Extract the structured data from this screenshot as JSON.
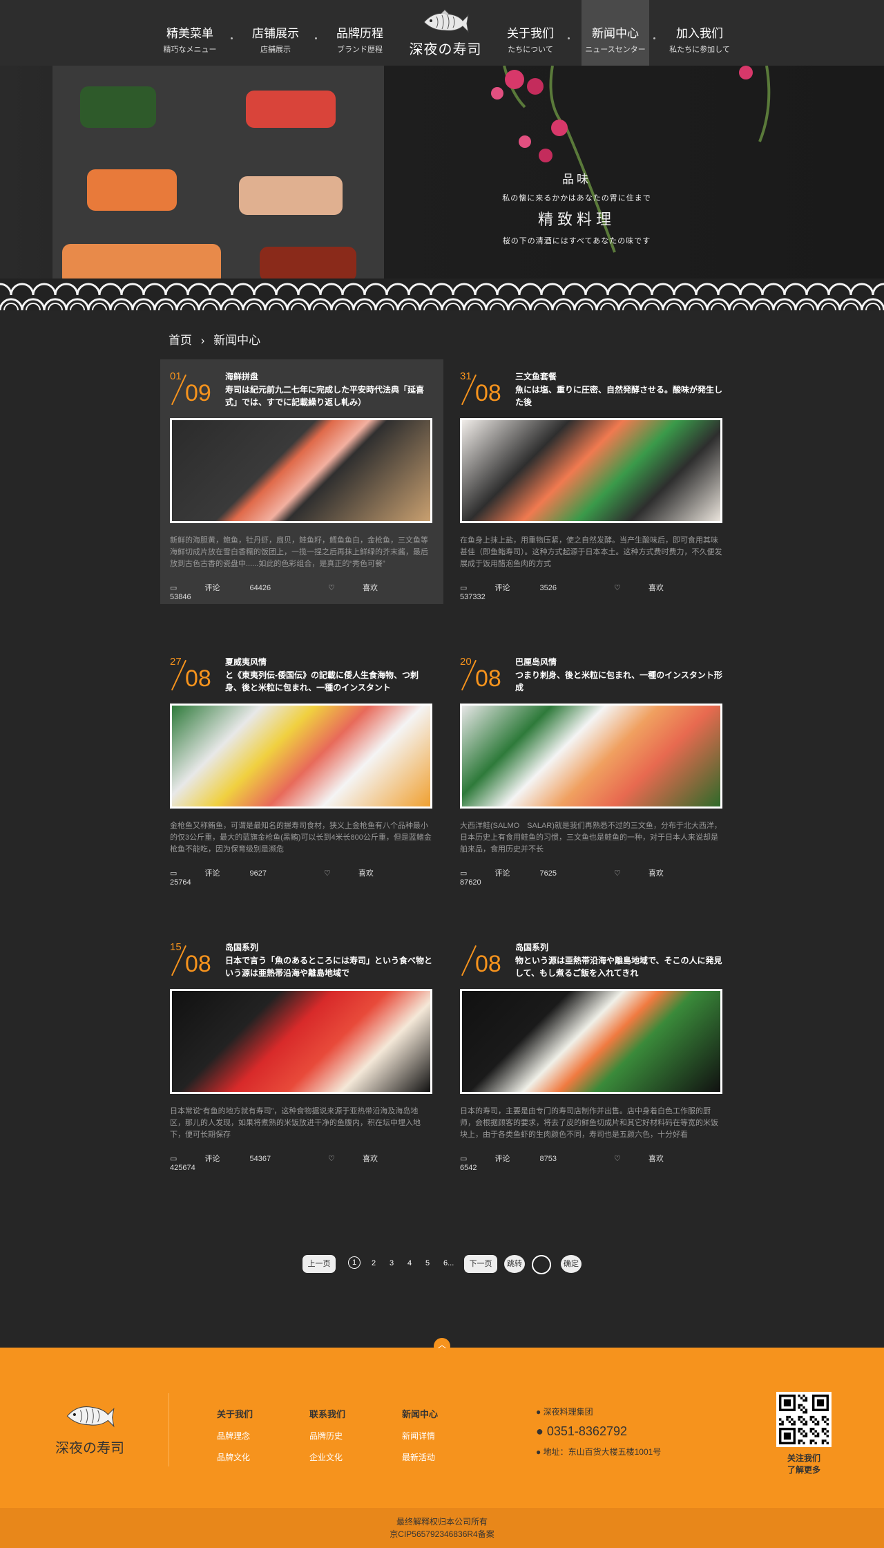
{
  "nav": {
    "items": [
      {
        "cn": "精美菜单",
        "jp": "精巧なメニュー"
      },
      {
        "cn": "店铺展示",
        "jp": "店舗展示"
      },
      {
        "cn": "品牌历程",
        "jp": "ブランド歴程"
      },
      {
        "cn": "关于我们",
        "jp": "たちについて"
      },
      {
        "cn": "新闻中心",
        "jp": "ニュースセンター"
      },
      {
        "cn": "加入我们",
        "jp": "私たちに参加して"
      }
    ],
    "logo_text": "深夜の寿司",
    "logo_icon": "fish-icon"
  },
  "banner": {
    "line1": "品味",
    "line2": "私の懐に来るかかはあなたの胃に住まで",
    "line3": "精致料理",
    "line4": "桜の下の清酒にはすべてあなたの味です"
  },
  "breadcrumb": {
    "home": "首页",
    "sep": "›",
    "current": "新闻中心"
  },
  "news": [
    {
      "day": "01",
      "month": "09",
      "category": "海鲜拼盘",
      "title": "寿司は紀元前九二七年に完成した平安時代法典「延喜式」では、すでに記載繰り返し軋み）",
      "desc": "新鲜的海胆黄，鲍鱼，牡丹虾，扇贝，鲑鱼籽，鳕鱼鱼白，金枪鱼，三文鱼等海鲜切成片放在雪白香糯的饭团上，一揽一捏之后再抹上鲜绿的芥末酱，最后放到古色古香的瓷盘中......如此的色彩组合，是真正的“秀色可餐”",
      "comment_label": "评论",
      "comments": "64426",
      "like_label": "喜欢",
      "likes": "53846"
    },
    {
      "day": "31",
      "month": "08",
      "category": "三文鱼套餐",
      "title": "魚には塩、重りに圧密、自然発酵させる。酸味が発生した後",
      "desc": "在鱼身上抹上盐，用重物压紧，使之自然发酵。当产生酸味后，即可食用其味甚佳（即鱼鮨寿司）。这种方式起源于日本本土。这种方式费时费力，不久便发展成于饭用醋泡鱼肉的方式",
      "comment_label": "评论",
      "comments": "3526",
      "like_label": "喜欢",
      "likes": "537332"
    },
    {
      "day": "27",
      "month": "08",
      "category": "夏威夷风情",
      "title": "と《東夷列伝-倭国伝》の記載に倭人生食海物、つ刺身、後と米粒に包まれ、一種のインスタント",
      "desc": "金枪鱼又称鲔鱼，可谓是最知名的握寿司食材，狭义上金枪鱼有八个品种最小的仅3公斤重，最大的蓝旗金枪鱼(黑鲔)可以长到4米长800公斤重，但是蓝鳍金枪鱼不能吃，因为保育级别是濒危",
      "comment_label": "评论",
      "comments": "9627",
      "like_label": "喜欢",
      "likes": "25764"
    },
    {
      "day": "20",
      "month": "08",
      "category": "巴厘岛风情",
      "title": "つまり刺身、後と米粒に包まれ、一種のインスタント形成",
      "desc": "大西洋鲑(SALMO　SALAR)就是我们再熟悉不过的三文鱼，分布于北大西洋，日本历史上有食用鲑鱼的习惯，三文鱼也是鲑鱼的一种，对于日本人来说却是舶来品，食用历史并不长",
      "comment_label": "评论",
      "comments": "7625",
      "like_label": "喜欢",
      "likes": "87620"
    },
    {
      "day": "15",
      "month": "08",
      "category": "岛国系列",
      "title": "日本で言う「魚のあるところには寿司」という食べ物という源は亜熱帯沿海や離島地域で",
      "desc": "日本常说“有鱼的地方就有寿司”，这种食物据说来源于亚热带沿海及海岛地区，那儿的人发现，如果将煮熟的米饭放进干净的鱼腹内，积在坛中埋入地下，便可长期保存",
      "comment_label": "评论",
      "comments": "54367",
      "like_label": "喜欢",
      "likes": "425674"
    },
    {
      "day": "",
      "month": "08",
      "category": "岛国系列",
      "title": "物という源は亜熱帯沿海や離島地域で、そこの人に発見して、もし煮るご飯を入れてきれ",
      "desc": "日本的寿司，主要是由专门的寿司店制作并出售。店中身着白色工作服的厨师，会根据顾客的要求，将去了皮的鲜鱼切成片和其它好材料码在等宽的米饭块上，由于各类鱼虾的生肉颜色不同，寿司也是五颜六色，十分好看",
      "comment_label": "评论",
      "comments": "8753",
      "like_label": "喜欢",
      "likes": "6542"
    }
  ],
  "pagination": {
    "prev": "上一页",
    "pages": [
      "1",
      "2",
      "3",
      "4",
      "5",
      "6..."
    ],
    "current": "1",
    "next": "下一页",
    "jump": "跳转",
    "ok": "确定"
  },
  "footer": {
    "logo_text": "深夜の寿司",
    "col1": {
      "title": "关于我们",
      "links": [
        "品牌理念",
        "品牌文化"
      ]
    },
    "col2": {
      "title": "联系我们",
      "links": [
        "品牌历史",
        "企业文化"
      ]
    },
    "col3": {
      "title": "新闻中心",
      "links": [
        "新闻详情",
        "最新活动"
      ]
    },
    "company": "深夜料理集团",
    "phone": "0351-8362792",
    "address": "地址：东山百货大楼五楼1001号",
    "qr_caption1": "关注我们",
    "qr_caption2": "了解更多",
    "copyright1": "最终解释权归本公司所有",
    "copyright2": "京CIP565792346836R4备案"
  },
  "colors": {
    "accent": "#f6931d",
    "bg": "#262626"
  }
}
